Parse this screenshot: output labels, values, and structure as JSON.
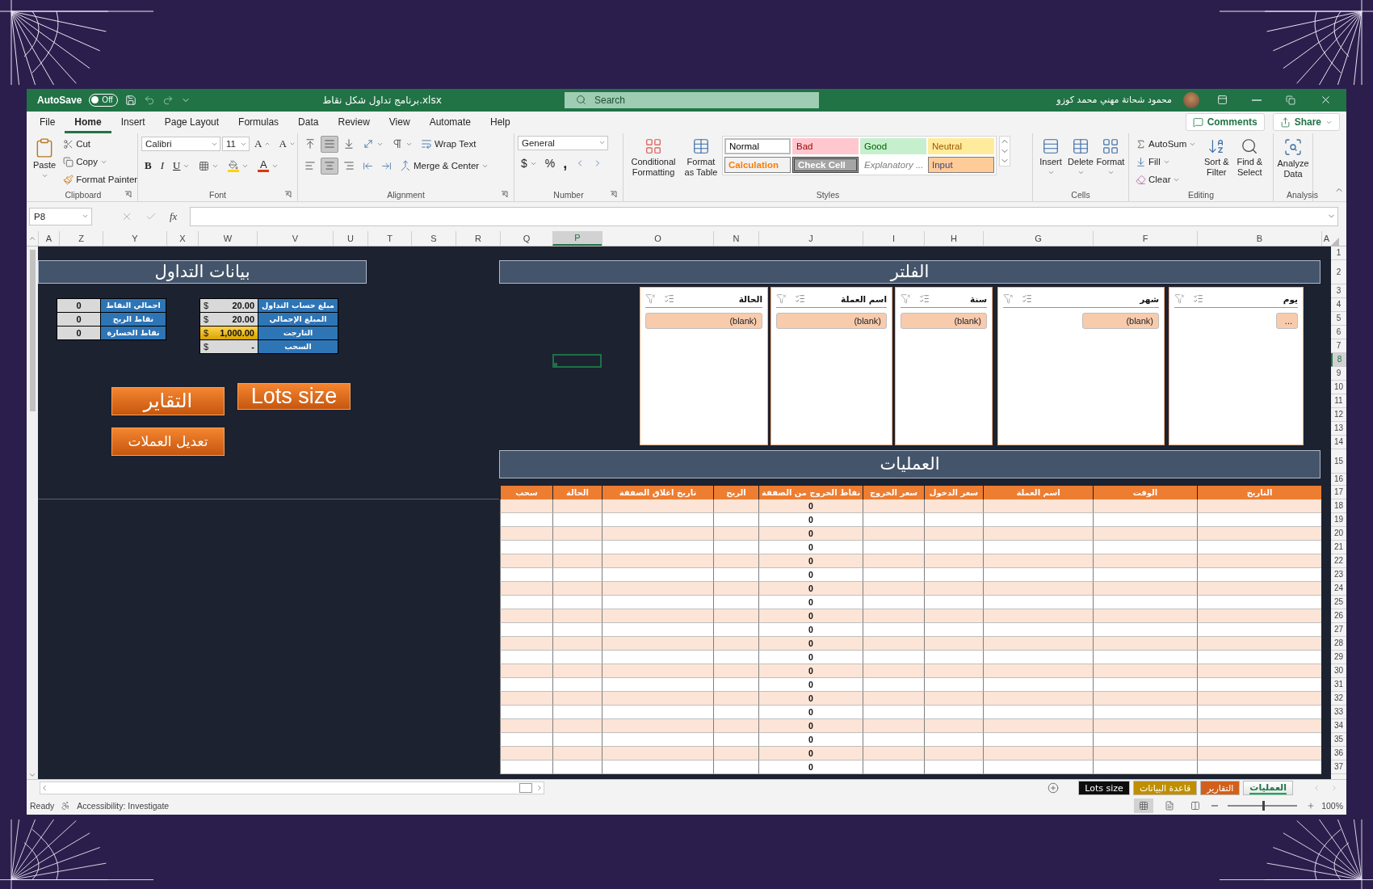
{
  "title_bar": {
    "autosave_label": "AutoSave",
    "autosave": {
      "on": false,
      "label": "Off"
    },
    "file_name": "برنامج تداول شكل نقاط.xlsx",
    "search_placeholder": "Search",
    "user_name": "محمود شحاتة مهني محمد كوزو"
  },
  "menu": {
    "tabs": [
      {
        "label": "Help",
        "selected": false
      },
      {
        "label": "Automate",
        "selected": false
      },
      {
        "label": "View",
        "selected": false
      },
      {
        "label": "Review",
        "selected": false
      },
      {
        "label": "Data",
        "selected": false
      },
      {
        "label": "Formulas",
        "selected": false
      },
      {
        "label": "Page Layout",
        "selected": false
      },
      {
        "label": "Insert",
        "selected": false
      },
      {
        "label": "Home",
        "selected": true
      },
      {
        "label": "File",
        "selected": false
      }
    ],
    "comments": "Comments",
    "share": "Share"
  },
  "ribbon": {
    "clipboard": {
      "paste": "Paste",
      "cut": "Cut",
      "copy": "Copy",
      "format_painter": "Format Painter",
      "label": "Clipboard"
    },
    "font": {
      "name": "Calibri",
      "size": "11",
      "grow": "A",
      "shrink": "A",
      "bold": "B",
      "italic": "I",
      "underline": "U",
      "font_color": "A",
      "label": "Font"
    },
    "alignment": {
      "vertical_align": [
        {
          "selected": false
        },
        {
          "selected": true
        },
        {
          "selected": false
        }
      ],
      "horizontal_align": [
        {
          "selected": false
        },
        {
          "selected": true
        },
        {
          "selected": false
        }
      ],
      "wrap_text": "Wrap Text",
      "merge_center": "Merge & Center",
      "label": "Alignment"
    },
    "number": {
      "format": "General",
      "currency": "$",
      "percent": "%",
      "comma": ",",
      "label": "Number"
    },
    "styles": {
      "conditional_formatting": "Conditional Formatting",
      "format_as_table": "Format as Table",
      "gallery": [
        {
          "label": "Neutral",
          "kind": "neutral"
        },
        {
          "label": "Good",
          "kind": "good"
        },
        {
          "label": "Bad",
          "kind": "bad"
        },
        {
          "label": "Normal",
          "kind": "normal"
        },
        {
          "label": "Input",
          "kind": "input"
        },
        {
          "label": "Explanatory ...",
          "kind": "explanatory"
        },
        {
          "label": "Check Cell",
          "kind": "check"
        },
        {
          "label": "Calculation",
          "kind": "calculation"
        }
      ],
      "label": "Styles"
    },
    "cells": {
      "buttons": [
        "Format",
        "Delete",
        "Insert"
      ],
      "label": "Cells"
    },
    "editing": {
      "autosum": "AutoSum",
      "fill": "Fill",
      "clear": "Clear",
      "sort_filter": "Sort & Filter",
      "find_select": "Find & Select",
      "label": "Editing"
    },
    "analysis": {
      "analyze_data": "Analyze Data",
      "label": "Analysis"
    }
  },
  "formula_bar": {
    "name_box": "P8",
    "function_label": "fx"
  },
  "columns": [
    {
      "label": "A",
      "selected": false
    },
    {
      "label": "B",
      "selected": false
    },
    {
      "label": "F",
      "selected": false
    },
    {
      "label": "G",
      "selected": false
    },
    {
      "label": "H",
      "selected": false
    },
    {
      "label": "I",
      "selected": false
    },
    {
      "label": "J",
      "selected": false
    },
    {
      "label": "N",
      "selected": false
    },
    {
      "label": "O",
      "selected": false
    },
    {
      "label": "P",
      "selected": true
    },
    {
      "label": "Q",
      "selected": false
    },
    {
      "label": "R",
      "selected": false
    },
    {
      "label": "S",
      "selected": false
    },
    {
      "label": "T",
      "selected": false
    },
    {
      "label": "U",
      "selected": false
    },
    {
      "label": "V",
      "selected": false
    },
    {
      "label": "W",
      "selected": false
    },
    {
      "label": "X",
      "selected": false
    },
    {
      "label": "Y",
      "selected": false
    },
    {
      "label": "Z",
      "selected": false
    },
    {
      "label": "A",
      "selected": false
    }
  ],
  "row_headers": [
    {
      "label": "1",
      "selected": false
    },
    {
      "label": "2",
      "selected": false
    },
    {
      "label": "3",
      "selected": false
    },
    {
      "label": "4",
      "selected": false
    },
    {
      "label": "5",
      "selected": false
    },
    {
      "label": "6",
      "selected": false
    },
    {
      "label": "7",
      "selected": false
    },
    {
      "label": "8",
      "selected": true
    },
    {
      "label": "9",
      "selected": false
    },
    {
      "label": "10",
      "selected": false
    },
    {
      "label": "11",
      "selected": false
    },
    {
      "label": "12",
      "selected": false
    },
    {
      "label": "13",
      "selected": false
    },
    {
      "label": "14",
      "selected": false
    },
    {
      "label": "15",
      "selected": false
    },
    {
      "label": "16",
      "selected": false
    },
    {
      "label": "17",
      "selected": false
    },
    {
      "label": "18",
      "selected": false
    },
    {
      "label": "19",
      "selected": false
    },
    {
      "label": "20",
      "selected": false
    },
    {
      "label": "21",
      "selected": false
    },
    {
      "label": "22",
      "selected": false
    },
    {
      "label": "23",
      "selected": false
    },
    {
      "label": "24",
      "selected": false
    },
    {
      "label": "25",
      "selected": false
    },
    {
      "label": "26",
      "selected": false
    },
    {
      "label": "27",
      "selected": false
    },
    {
      "label": "28",
      "selected": false
    },
    {
      "label": "29",
      "selected": false
    },
    {
      "label": "30",
      "selected": false
    },
    {
      "label": "31",
      "selected": false
    },
    {
      "label": "32",
      "selected": false
    },
    {
      "label": "33",
      "selected": false
    },
    {
      "label": "34",
      "selected": false
    },
    {
      "label": "35",
      "selected": false
    },
    {
      "label": "36",
      "selected": false
    },
    {
      "label": "37",
      "selected": false
    }
  ],
  "trading_panel": {
    "title": "بيانات التداول",
    "points_table": [
      {
        "label": "اجمالي النقاط",
        "value": "0"
      },
      {
        "label": "نقاط الربح",
        "value": "0"
      },
      {
        "label": "نقاط الخسارة",
        "value": "0"
      }
    ],
    "account_table": [
      {
        "label": "مبلغ حساب التداول",
        "currency": "$",
        "value": "20.00",
        "highlighted": false
      },
      {
        "label": "المبلغ الإجمالي",
        "currency": "$",
        "value": "20.00",
        "highlighted": false
      },
      {
        "label": "التارجت",
        "currency": "$",
        "value": "1,000.00",
        "highlighted": true
      },
      {
        "label": "السحب",
        "currency": "$",
        "value": "-",
        "highlighted": false
      }
    ],
    "buttons": [
      "التقاير",
      "Lots size",
      "تعديل العملات"
    ]
  },
  "filter_panel": {
    "title": "الفلتر",
    "slicers": [
      {
        "title": "يوم",
        "items": [
          "..."
        ]
      },
      {
        "title": "شهر",
        "items": [
          "(blank)"
        ]
      },
      {
        "title": "سنة",
        "items": [
          "(blank)"
        ]
      },
      {
        "title": "اسم العملة",
        "items": [
          "(blank)"
        ]
      },
      {
        "title": "الحالة",
        "items": [
          "(blank)"
        ]
      }
    ]
  },
  "operations": {
    "title": "العمليات",
    "columns": [
      "التاريخ",
      "الوقت",
      "اسم العملة",
      "سعر الدخول",
      "سعر الخروج",
      "نقاط الخروج من الصفقة",
      "الربح",
      "تاريخ اغلاق الصفقة",
      "الحالة",
      "سحب"
    ],
    "rows": [
      {
        "exit_points": "0"
      },
      {
        "exit_points": "0"
      },
      {
        "exit_points": "0"
      },
      {
        "exit_points": "0"
      },
      {
        "exit_points": "0"
      },
      {
        "exit_points": "0"
      },
      {
        "exit_points": "0"
      },
      {
        "exit_points": "0"
      },
      {
        "exit_points": "0"
      },
      {
        "exit_points": "0"
      },
      {
        "exit_points": "0"
      },
      {
        "exit_points": "0"
      },
      {
        "exit_points": "0"
      },
      {
        "exit_points": "0"
      },
      {
        "exit_points": "0"
      },
      {
        "exit_points": "0"
      },
      {
        "exit_points": "0"
      },
      {
        "exit_points": "0"
      },
      {
        "exit_points": "0"
      },
      {
        "exit_points": "0"
      }
    ]
  },
  "sheet_tabs": [
    {
      "label": "العمليات",
      "selected": true,
      "color": "#00b050"
    },
    {
      "label": "التقارير",
      "selected": false,
      "color": "#d2601a"
    },
    {
      "label": "قاعدة البيانات",
      "selected": false,
      "color": "#bf8f00"
    },
    {
      "label": "Lots size",
      "selected": false,
      "color": "#0d0d0d"
    }
  ],
  "status_bar": {
    "ready": "Ready",
    "accessibility": "Accessibility: Investigate",
    "views": [
      {
        "kind": "normal",
        "selected": true
      },
      {
        "kind": "page_layout",
        "selected": false
      },
      {
        "kind": "page_break",
        "selected": false
      }
    ],
    "zoom": {
      "level": 0.5,
      "label": "100%"
    }
  }
}
